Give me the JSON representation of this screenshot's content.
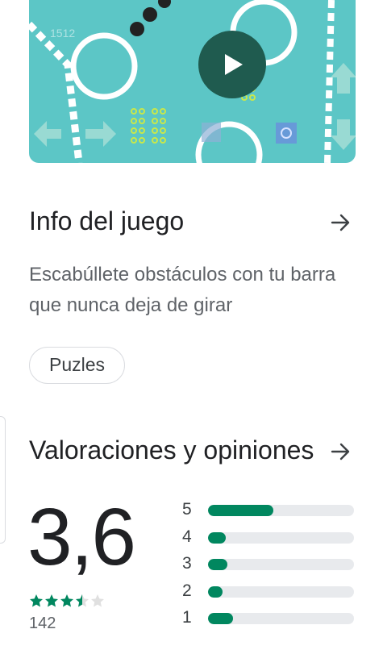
{
  "banner": {
    "background_color": "#5cc6c6",
    "play_icon": "play-icon",
    "score_text": "1512"
  },
  "info": {
    "title": "Info del juego",
    "arrow_icon": "arrow-right-icon",
    "description": "Escabúllete obstáculos con tu barra que nunca deja de girar",
    "chip_label": "Puzles"
  },
  "ratings": {
    "title": "Valoraciones y opiniones",
    "arrow_icon": "arrow-right-icon",
    "score": "3,6",
    "stars_filled": 3.5,
    "stars_total": 5,
    "review_count": "142",
    "accent_color": "#01875f",
    "histogram": [
      {
        "label": "5",
        "fraction": 0.45
      },
      {
        "label": "4",
        "fraction": 0.12
      },
      {
        "label": "3",
        "fraction": 0.13
      },
      {
        "label": "2",
        "fraction": 0.1
      },
      {
        "label": "1",
        "fraction": 0.17
      }
    ]
  }
}
